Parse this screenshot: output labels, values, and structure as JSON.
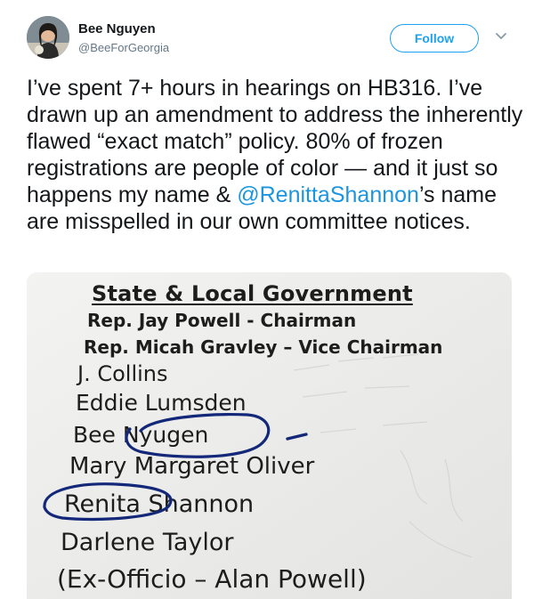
{
  "author": {
    "display_name": "Bee Nguyen",
    "handle": "@BeeForGeorgia",
    "avatar_icon": "profile-photo"
  },
  "actions": {
    "follow_label": "Follow",
    "menu_icon": "chevron-down-icon"
  },
  "tweet": {
    "text_before_mention": "I’ve spent 7+ hours in hearings on HB316. I’ve drawn up an amendment to address the inherently flawed “exact match” policy. 80% of frozen registrations are people of color — and it just so happens my name & ",
    "mention": "@RenittaShannon",
    "text_after_mention": "’s name are misspelled in our own committee notices."
  },
  "photo": {
    "title": "State & Local Government",
    "lines": [
      "Rep. Jay Powell - Chairman",
      "Rep. Micah Gravley – Vice Chairman",
      "J. Collins",
      "Eddie Lumsden",
      "Bee Nyugen",
      "Mary Margaret Oliver",
      "Renita Shannon",
      "Darlene Taylor",
      "(Ex-Officio – Alan Powell)"
    ]
  },
  "colors": {
    "link": "#1b95e0",
    "follow": "#1da1f2",
    "ink": "#14287a"
  }
}
